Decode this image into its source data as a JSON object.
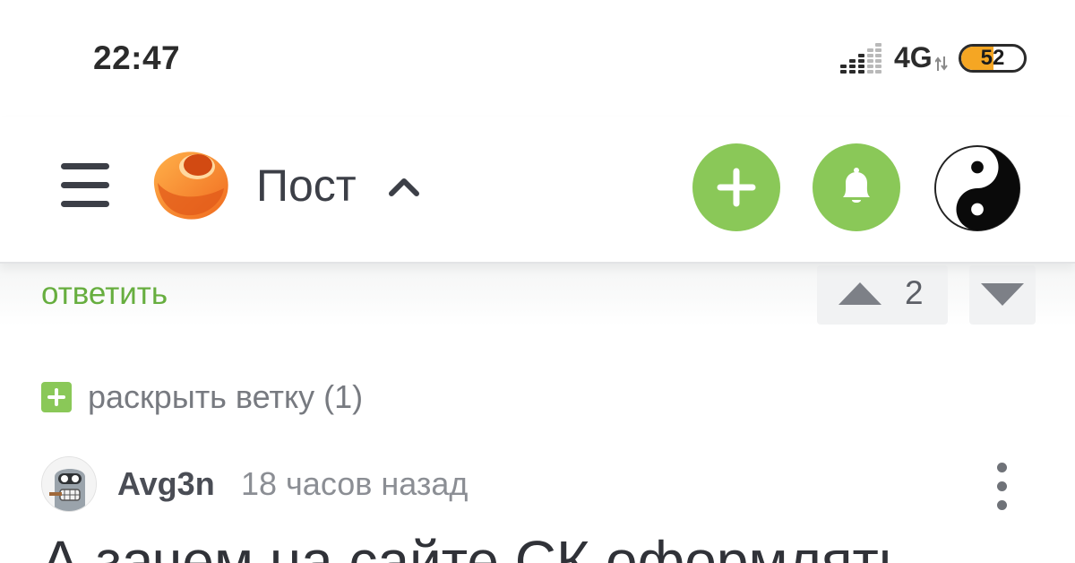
{
  "status_bar": {
    "time": "22:47",
    "network": "4G",
    "battery_level": "52",
    "battery_fraction": 0.52,
    "battery_color": "#f5a623",
    "signal_icon": "signal-bars-icon",
    "data_icon": "data-arrows-icon"
  },
  "header": {
    "menu_icon": "hamburger-menu-icon",
    "logo_icon": "pikabu-logo-icon",
    "title": "Пост",
    "title_toggle_icon": "chevron-up-icon",
    "add_icon": "plus-icon",
    "notifications_icon": "bell-icon",
    "avatar_icon": "yin-yang-avatar",
    "accent_color": "#8ac858"
  },
  "comment_top": {
    "reply_label": "ответить",
    "rating": "2",
    "vote_up_icon": "triangle-up-icon",
    "vote_down_icon": "triangle-down-icon",
    "link_color": "#67ae3f"
  },
  "thread": {
    "expand_label": "раскрыть ветку (1)",
    "expand_icon": "plus-square-icon"
  },
  "comment": {
    "author": "Avg3n",
    "time": "18 часов назад",
    "more_icon": "more-vertical-icon",
    "text": "А зачем на сайте СК оформлять"
  }
}
